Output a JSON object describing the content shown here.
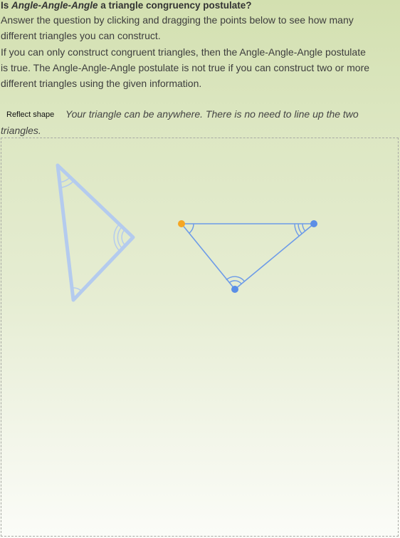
{
  "question": {
    "prefix": "Is ",
    "emph": "Angle-Angle-Angle",
    "suffix": " a triangle congruency postulate?"
  },
  "instructions": {
    "p1": "Answer the question by clicking and dragging the points below to see how many different triangles you can construct.",
    "p2": "If you can only construct congruent triangles, then the Angle-Angle-Angle postulate is true. The Angle-Angle-Angle postulate is not true if you can construct two or more different triangles using the given information."
  },
  "reflect_button": {
    "label": "Reflect shape"
  },
  "hint": "Your triangle can be anywhere. There is no need to line up the two triangles.",
  "colors": {
    "reference_triangle": "#b4cbee",
    "user_triangle": "#6d9be8",
    "point_blue": "#5b8ee6",
    "point_orange": "#f5a623"
  },
  "icons": {
    "point_handle": "circle"
  }
}
